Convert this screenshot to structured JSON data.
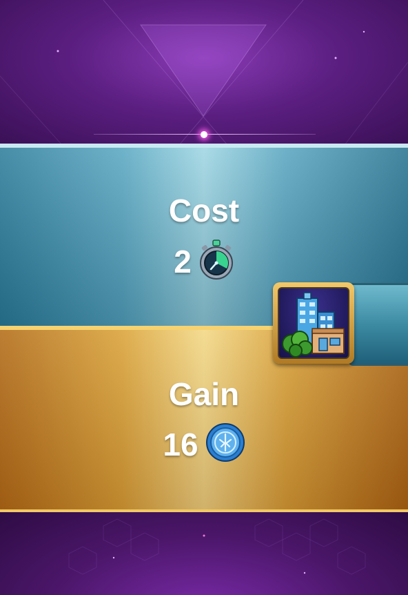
{
  "cost": {
    "label": "Cost",
    "amount": "2",
    "icon": "stopwatch-icon"
  },
  "gain": {
    "label": "Gain",
    "amount": "16",
    "icon": "blue-coin-icon"
  },
  "card": {
    "icon": "city-buildings-icon"
  },
  "colors": {
    "cost_panel": "#5aa8c2",
    "gain_panel": "#d9a23a",
    "background": "#5c1f82",
    "dot_glow": "#ff5cf0"
  }
}
